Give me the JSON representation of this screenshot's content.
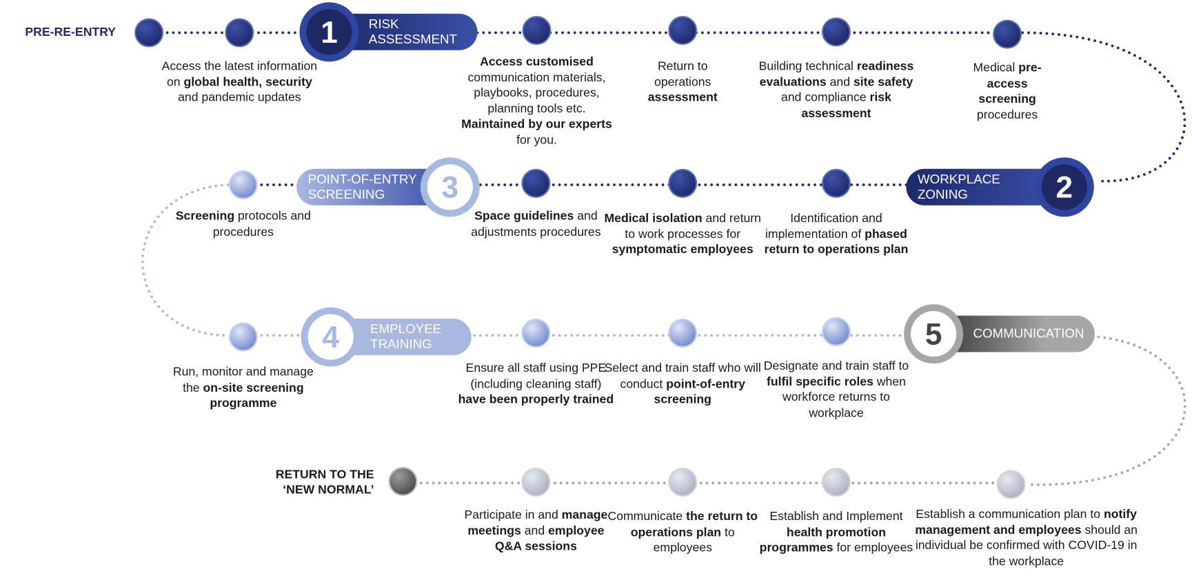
{
  "start_label": "PRE-RE-ENTRY",
  "end_label": [
    "RETURN TO THE",
    "‘NEW NORMAL’"
  ],
  "colors": {
    "navy": "#1f2a6b",
    "blue": "#3a4fa8",
    "light_blue": "#a9b8e0",
    "gray": "#a6a6a6",
    "dark_gray": "#3a3a3a"
  },
  "stages": [
    {
      "number": "1",
      "title": [
        "RISK",
        "ASSESSMENT"
      ]
    },
    {
      "number": "2",
      "title": [
        "WORKPLACE",
        "ZONING"
      ]
    },
    {
      "number": "3",
      "title": [
        "POINT-OF-ENTRY",
        "SCREENING"
      ]
    },
    {
      "number": "4",
      "title": [
        "EMPLOYEE",
        "TRAINING"
      ]
    },
    {
      "number": "5",
      "title": [
        "COMMUNICATION"
      ]
    }
  ],
  "steps": [
    [
      [
        "Access the latest information on ",
        0
      ],
      [
        "global health, security",
        1
      ],
      [
        " and pandemic updates",
        0
      ]
    ],
    [
      [
        "Access customised",
        1
      ],
      [
        " communication materials, playbooks, procedures, planning tools etc. ",
        0
      ],
      [
        "Maintained by our experts",
        1
      ],
      [
        " for you.",
        0
      ]
    ],
    [
      [
        "Return to operations ",
        0
      ],
      [
        "assessment",
        1
      ]
    ],
    [
      [
        "Building technical ",
        0
      ],
      [
        "readiness evaluations",
        1
      ],
      [
        " and ",
        0
      ],
      [
        "site safety",
        1
      ],
      [
        " and compliance ",
        0
      ],
      [
        "risk assessment",
        1
      ]
    ],
    [
      [
        "Medical ",
        0
      ],
      [
        "pre-access screening",
        1
      ],
      [
        " procedures",
        0
      ]
    ],
    [
      [
        "Identification and implementation of ",
        0
      ],
      [
        "phased return to operations plan",
        1
      ]
    ],
    [
      [
        "Medical isolation",
        1
      ],
      [
        " and return to work processes for ",
        0
      ],
      [
        "symptomatic employees",
        1
      ]
    ],
    [
      [
        "Space guidelines",
        1
      ],
      [
        " and adjustments procedures",
        0
      ]
    ],
    [
      [
        "Screening",
        1
      ],
      [
        " protocols and procedures",
        0
      ]
    ],
    [
      [
        "Run, monitor and manage the ",
        0
      ],
      [
        "on-site screening programme",
        1
      ]
    ],
    [
      [
        "Ensure all staff using PPE (including cleaning staff) ",
        0
      ],
      [
        "have been properly trained",
        1
      ]
    ],
    [
      [
        "Select and train staff who will conduct ",
        0
      ],
      [
        "point-of-entry screening",
        1
      ]
    ],
    [
      [
        "Designate and train staff to ",
        0
      ],
      [
        "fulfil specific roles",
        1
      ],
      [
        " when workforce returns to workplace",
        0
      ]
    ],
    [
      [
        "Establish a communication plan to ",
        0
      ],
      [
        "notify management and employees",
        1
      ],
      [
        " should an individual be confirmed with COVID-19 in the workplace",
        0
      ]
    ],
    [
      [
        "Establish and Implement ",
        0
      ],
      [
        "health promotion programmes",
        1
      ],
      [
        " for employees",
        0
      ]
    ],
    [
      [
        "Communicate ",
        0
      ],
      [
        "the return to operations plan",
        1
      ],
      [
        " to employees",
        0
      ]
    ],
    [
      [
        "Participate in and ",
        0
      ],
      [
        "manage meetings",
        1
      ],
      [
        " and ",
        0
      ],
      [
        "employee Q&A sessions",
        1
      ]
    ]
  ]
}
